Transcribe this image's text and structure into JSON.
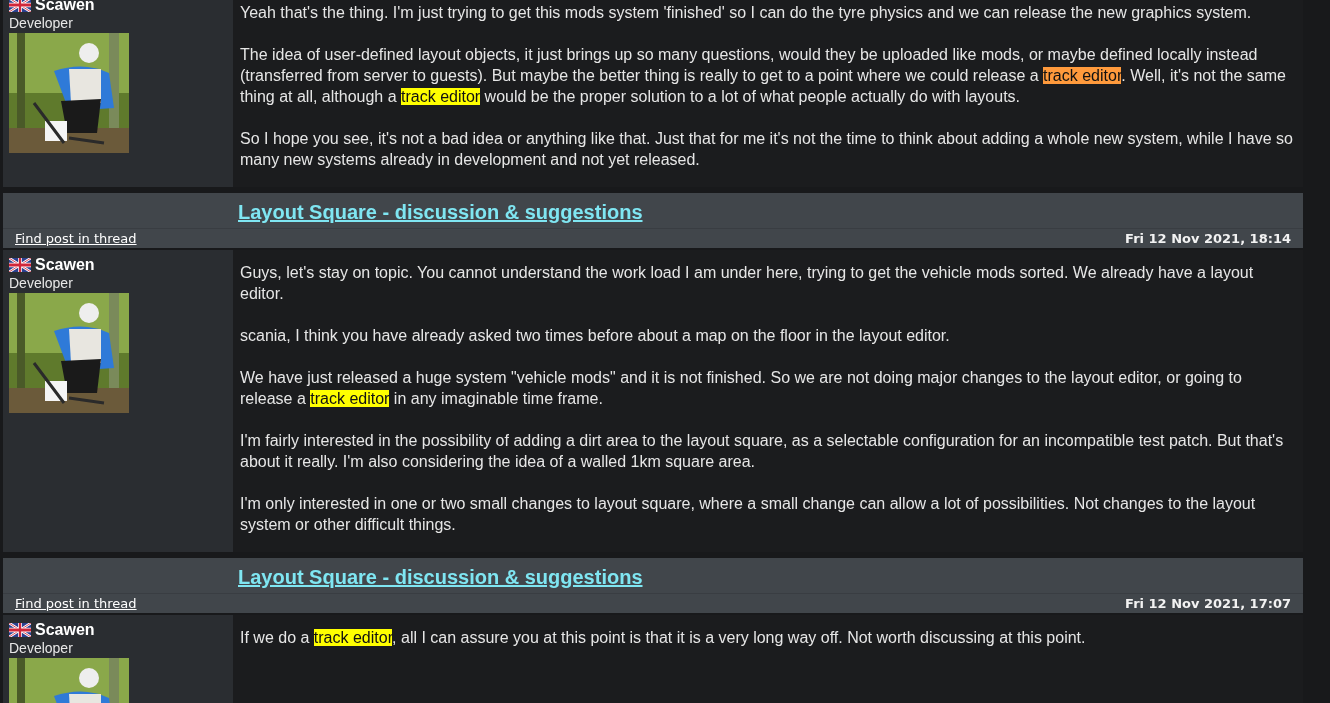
{
  "posts": [
    {
      "author": {
        "name": "Scawen",
        "role": "Developer"
      },
      "paragraphs": [
        [
          {
            "text": "Yeah that's the thing. I'm just trying to get this mods system 'finished' so I can do the tyre physics and we can release the new graphics system."
          }
        ],
        [
          {
            "text": "The idea of user-defined layout objects, it just brings up so many questions, would they be uploaded like mods, or maybe defined locally instead (transferred from server to guests). But maybe the better thing is really to get to a point where we could release a "
          },
          {
            "text": "track editor",
            "color": "#ff9a3c"
          },
          {
            "text": ". Well, it's not the same thing at all, although a "
          },
          {
            "text": "track editor",
            "color": "#ffff00"
          },
          {
            "text": " would be the proper solution to a lot of what people actually do with layouts."
          }
        ],
        [
          {
            "text": "So I hope you see, it's not a bad idea or anything like that. Just that for me it's not the time to think about adding a whole new system, while I have so many new systems already in development and not yet released."
          }
        ]
      ]
    },
    {
      "thread_title": "Layout Square - discussion & suggestions",
      "find_link": "Find post in thread",
      "date": "Fri 12 Nov 2021, 18:14",
      "author": {
        "name": "Scawen",
        "role": "Developer"
      },
      "paragraphs": [
        [
          {
            "text": "Guys, let's stay on topic. You cannot understand the work load I am under here, trying to get the vehicle mods sorted. We already have a layout editor."
          }
        ],
        [
          {
            "text": "scania, I think you have already asked two times before about a map on the floor in the layout editor."
          }
        ],
        [
          {
            "text": "We have just released a huge system \"vehicle mods\" and it is not finished. So we are not doing major changes to the layout editor, or going to release a "
          },
          {
            "text": "track editor",
            "color": "#ffff00"
          },
          {
            "text": " in any imaginable time frame."
          }
        ],
        [
          {
            "text": "I'm fairly interested in the possibility of adding a dirt area to the layout square, as a selectable configuration for an incompatible test patch. But that's about it really. I'm also considering the idea of a walled 1km square area."
          }
        ],
        [
          {
            "text": "I'm only interested in one or two small changes to layout square, where a small change can allow a lot of possibilities. Not changes to the layout system or other difficult things."
          }
        ]
      ]
    },
    {
      "thread_title": "Layout Square - discussion & suggestions",
      "find_link": "Find post in thread",
      "date": "Fri 12 Nov 2021, 17:07",
      "author": {
        "name": "Scawen",
        "role": "Developer"
      },
      "paragraphs": [
        [
          {
            "text": "If we do a "
          },
          {
            "text": "track editor",
            "color": "#ffff00"
          },
          {
            "text": ", all I can assure you at this point is that it is a very long way off. Not worth discussing at this point."
          }
        ]
      ]
    }
  ]
}
